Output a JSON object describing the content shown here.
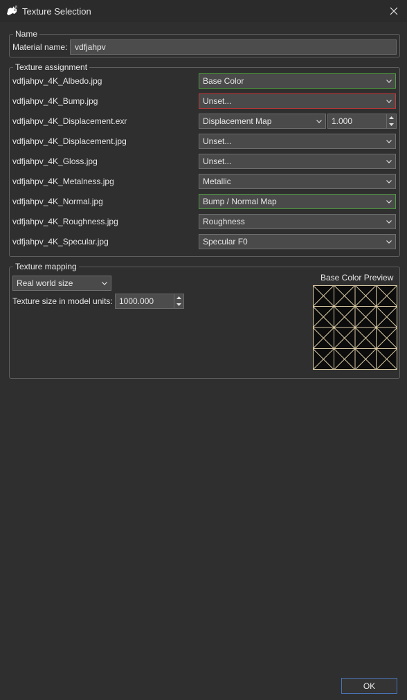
{
  "window": {
    "title": "Texture Selection"
  },
  "name_group": {
    "legend": "Name",
    "material_label": "Material name:",
    "material_value": "vdfjahpv"
  },
  "assignment_group": {
    "legend": "Texture assignment",
    "rows": [
      {
        "file": "vdfjahpv_4K_Albedo.jpg",
        "channel": "Base Color",
        "state": "valid"
      },
      {
        "file": "vdfjahpv_4K_Bump.jpg",
        "channel": "Unset...",
        "state": "error"
      },
      {
        "file": "vdfjahpv_4K_Displacement.exr",
        "channel": "Displacement Map",
        "state": "normal",
        "amount": "1.000"
      },
      {
        "file": "vdfjahpv_4K_Displacement.jpg",
        "channel": "Unset...",
        "state": "normal"
      },
      {
        "file": "vdfjahpv_4K_Gloss.jpg",
        "channel": "Unset...",
        "state": "normal"
      },
      {
        "file": "vdfjahpv_4K_Metalness.jpg",
        "channel": "Metallic",
        "state": "normal"
      },
      {
        "file": "vdfjahpv_4K_Normal.jpg",
        "channel": "Bump / Normal Map",
        "state": "valid"
      },
      {
        "file": "vdfjahpv_4K_Roughness.jpg",
        "channel": "Roughness",
        "state": "normal"
      },
      {
        "file": "vdfjahpv_4K_Specular.jpg",
        "channel": "Specular F0",
        "state": "normal"
      }
    ]
  },
  "mapping_group": {
    "legend": "Texture mapping",
    "size_mode": "Real world size",
    "size_label": "Texture size in model units:",
    "size_value": "1000.000",
    "preview_title": "Base Color Preview"
  },
  "footer": {
    "ok_label": "OK"
  },
  "colors": {
    "background": "#2f2f2f",
    "valid_border": "#4e9a40",
    "error_border": "#c23a3a",
    "ok_border": "#4a74b8",
    "preview_lines": "#d8c9a3"
  },
  "icons": {
    "app": "rhino-icon",
    "close": "close-icon",
    "dropdown": "chevron-down-icon",
    "spin_up": "spin-up-icon",
    "spin_down": "spin-down-icon"
  }
}
